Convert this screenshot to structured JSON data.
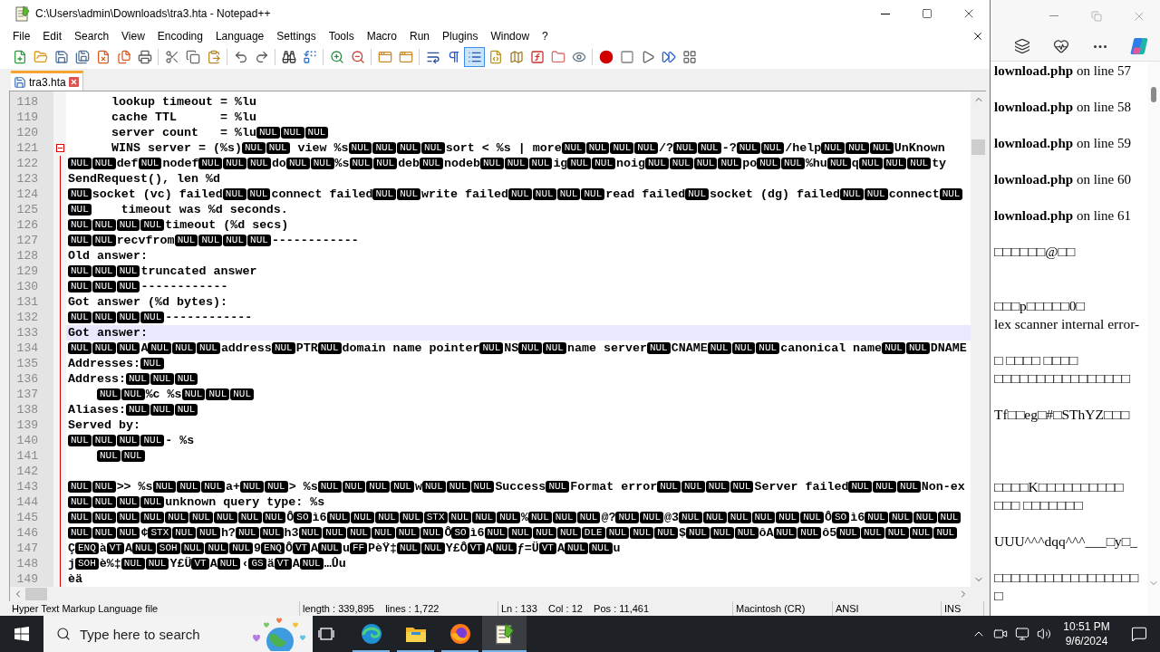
{
  "window": {
    "title": "C:\\Users\\admin\\Downloads\\tra3.hta - Notepad++"
  },
  "menu": [
    "File",
    "Edit",
    "Search",
    "View",
    "Encoding",
    "Language",
    "Settings",
    "Tools",
    "Macro",
    "Run",
    "Plugins",
    "Window",
    "?"
  ],
  "toolbar": [
    [
      {
        "selected": false
      },
      {
        "selected": false
      },
      {
        "selected": false
      },
      {
        "selected": false
      },
      {
        "selected": false
      },
      {
        "selected": false
      },
      {
        "selected": false
      }
    ],
    [
      {
        "selected": false
      },
      {
        "selected": false
      },
      {
        "selected": false
      }
    ],
    [
      {
        "selected": false
      },
      {
        "selected": false
      }
    ],
    [
      {
        "selected": false
      },
      {
        "selected": false
      }
    ],
    [
      {
        "selected": false
      },
      {
        "selected": false
      }
    ],
    [
      {
        "selected": false
      },
      {
        "selected": false
      }
    ],
    [
      {
        "selected": false
      },
      {
        "selected": false
      },
      {
        "selected": true
      },
      {
        "selected": false
      },
      {
        "selected": false
      },
      {
        "selected": false
      },
      {
        "selected": false
      },
      {
        "selected": false
      }
    ],
    [
      {
        "selected": false
      },
      {
        "selected": false
      },
      {
        "selected": false
      },
      {
        "selected": false
      },
      {
        "selected": false
      }
    ]
  ],
  "tabs": [
    {
      "label": "tra3.hta",
      "selected": true
    }
  ],
  "editor": {
    "lines": [
      {
        "number": "118",
        "current": false,
        "segments": [
          "      lookup timeout = %lu"
        ]
      },
      {
        "number": "119",
        "current": false,
        "segments": [
          "      cache TTL      = %lu"
        ]
      },
      {
        "number": "120",
        "current": false,
        "segments": [
          "      server count   = %lu",
          {
            "ctrl": "NUL"
          },
          {
            "ctrl": "NUL"
          },
          {
            "ctrl": "NUL"
          }
        ]
      },
      {
        "number": "121",
        "current": false,
        "expanded": true,
        "segments": [
          "      WINS server = (%s)",
          {
            "ctrl": "NUL"
          },
          {
            "ctrl": "NUL"
          },
          " view %s",
          {
            "ctrl": "NUL"
          },
          {
            "ctrl": "NUL"
          },
          {
            "ctrl": "NUL"
          },
          {
            "ctrl": "NUL"
          },
          "sort < %s | more",
          {
            "ctrl": "NUL"
          },
          {
            "ctrl": "NUL"
          },
          {
            "ctrl": "NUL"
          },
          {
            "ctrl": "NUL"
          },
          "/?",
          {
            "ctrl": "NUL"
          },
          {
            "ctrl": "NUL"
          },
          "-?",
          {
            "ctrl": "NUL"
          },
          {
            "ctrl": "NUL"
          },
          "/help",
          {
            "ctrl": "NUL"
          },
          {
            "ctrl": "NUL"
          },
          {
            "ctrl": "NUL"
          },
          "UnKnown"
        ]
      },
      {
        "number": "122",
        "current": false,
        "segments": [
          {
            "ctrl": "NUL"
          },
          {
            "ctrl": "NUL"
          },
          "def",
          {
            "ctrl": "NUL"
          },
          "nodef",
          {
            "ctrl": "NUL"
          },
          {
            "ctrl": "NUL"
          },
          {
            "ctrl": "NUL"
          },
          "do",
          {
            "ctrl": "NUL"
          },
          {
            "ctrl": "NUL"
          },
          "%s",
          {
            "ctrl": "NUL"
          },
          {
            "ctrl": "NUL"
          },
          "deb",
          {
            "ctrl": "NUL"
          },
          "nodeb",
          {
            "ctrl": "NUL"
          },
          {
            "ctrl": "NUL"
          },
          {
            "ctrl": "NUL"
          },
          "ig",
          {
            "ctrl": "NUL"
          },
          {
            "ctrl": "NUL"
          },
          "noig",
          {
            "ctrl": "NUL"
          },
          {
            "ctrl": "NUL"
          },
          {
            "ctrl": "NUL"
          },
          {
            "ctrl": "NUL"
          },
          "po",
          {
            "ctrl": "NUL"
          },
          {
            "ctrl": "NUL"
          },
          "%hu",
          {
            "ctrl": "NUL"
          },
          "q",
          {
            "ctrl": "NUL"
          },
          {
            "ctrl": "NUL"
          },
          {
            "ctrl": "NUL"
          },
          "ty"
        ]
      },
      {
        "number": "123",
        "current": false,
        "segments": [
          "SendRequest(), len %d"
        ]
      },
      {
        "number": "124",
        "current": false,
        "segments": [
          {
            "ctrl": "NUL"
          },
          "socket (vc) failed",
          {
            "ctrl": "NUL"
          },
          {
            "ctrl": "NUL"
          },
          "connect failed",
          {
            "ctrl": "NUL"
          },
          {
            "ctrl": "NUL"
          },
          "write failed",
          {
            "ctrl": "NUL"
          },
          {
            "ctrl": "NUL"
          },
          {
            "ctrl": "NUL"
          },
          {
            "ctrl": "NUL"
          },
          "read failed",
          {
            "ctrl": "NUL"
          },
          "socket (dg) failed",
          {
            "ctrl": "NUL"
          },
          {
            "ctrl": "NUL"
          },
          "connect",
          {
            "ctrl": "NUL"
          }
        ]
      },
      {
        "number": "125",
        "current": false,
        "segments": [
          {
            "ctrl": "NUL"
          },
          "    timeout was %d seconds."
        ]
      },
      {
        "number": "126",
        "current": false,
        "segments": [
          {
            "ctrl": "NUL"
          },
          {
            "ctrl": "NUL"
          },
          {
            "ctrl": "NUL"
          },
          {
            "ctrl": "NUL"
          },
          "timeout (%d secs)"
        ]
      },
      {
        "number": "127",
        "current": false,
        "segments": [
          {
            "ctrl": "NUL"
          },
          {
            "ctrl": "NUL"
          },
          "recvfrom",
          {
            "ctrl": "NUL"
          },
          {
            "ctrl": "NUL"
          },
          {
            "ctrl": "NUL"
          },
          {
            "ctrl": "NUL"
          },
          "------------"
        ]
      },
      {
        "number": "128",
        "current": false,
        "segments": [
          "Old answer:"
        ]
      },
      {
        "number": "129",
        "current": false,
        "segments": [
          {
            "ctrl": "NUL"
          },
          {
            "ctrl": "NUL"
          },
          {
            "ctrl": "NUL"
          },
          "truncated answer"
        ]
      },
      {
        "number": "130",
        "current": false,
        "segments": [
          {
            "ctrl": "NUL"
          },
          {
            "ctrl": "NUL"
          },
          {
            "ctrl": "NUL"
          },
          "------------"
        ]
      },
      {
        "number": "131",
        "current": false,
        "segments": [
          "Got answer (%d bytes):"
        ]
      },
      {
        "number": "132",
        "current": false,
        "segments": [
          {
            "ctrl": "NUL"
          },
          {
            "ctrl": "NUL"
          },
          {
            "ctrl": "NUL"
          },
          {
            "ctrl": "NUL"
          },
          "------------"
        ]
      },
      {
        "number": "133",
        "current": true,
        "segments": [
          "Got answer:"
        ]
      },
      {
        "number": "134",
        "current": false,
        "segments": [
          {
            "ctrl": "NUL"
          },
          {
            "ctrl": "NUL"
          },
          {
            "ctrl": "NUL"
          },
          "A",
          {
            "ctrl": "NUL"
          },
          {
            "ctrl": "NUL"
          },
          {
            "ctrl": "NUL"
          },
          "address",
          {
            "ctrl": "NUL"
          },
          "PTR",
          {
            "ctrl": "NUL"
          },
          "domain name pointer",
          {
            "ctrl": "NUL"
          },
          "NS",
          {
            "ctrl": "NUL"
          },
          {
            "ctrl": "NUL"
          },
          "name server",
          {
            "ctrl": "NUL"
          },
          "CNAME",
          {
            "ctrl": "NUL"
          },
          {
            "ctrl": "NUL"
          },
          {
            "ctrl": "NUL"
          },
          "canonical name",
          {
            "ctrl": "NUL"
          },
          {
            "ctrl": "NUL"
          },
          "DNAME"
        ]
      },
      {
        "number": "135",
        "current": false,
        "segments": [
          "Addresses:",
          {
            "ctrl": "NUL"
          }
        ]
      },
      {
        "number": "136",
        "current": false,
        "segments": [
          "Address:",
          {
            "ctrl": "NUL"
          },
          {
            "ctrl": "NUL"
          },
          {
            "ctrl": "NUL"
          }
        ]
      },
      {
        "number": "137",
        "current": false,
        "indented": true,
        "segments": [
          {
            "ctrl": "NUL"
          },
          {
            "ctrl": "NUL"
          },
          "%c %s",
          {
            "ctrl": "NUL"
          },
          {
            "ctrl": "NUL"
          },
          {
            "ctrl": "NUL"
          }
        ]
      },
      {
        "number": "138",
        "current": false,
        "segments": [
          "Aliases:",
          {
            "ctrl": "NUL"
          },
          {
            "ctrl": "NUL"
          },
          {
            "ctrl": "NUL"
          }
        ]
      },
      {
        "number": "139",
        "current": false,
        "segments": [
          "Served by:"
        ]
      },
      {
        "number": "140",
        "current": false,
        "segments": [
          {
            "ctrl": "NUL"
          },
          {
            "ctrl": "NUL"
          },
          {
            "ctrl": "NUL"
          },
          {
            "ctrl": "NUL"
          },
          "- %s"
        ]
      },
      {
        "number": "141",
        "current": false,
        "indented": true,
        "segments": [
          {
            "ctrl": "NUL"
          },
          {
            "ctrl": "NUL"
          }
        ]
      },
      {
        "number": "142",
        "current": false
      },
      {
        "number": "143",
        "current": false,
        "segments": [
          {
            "ctrl": "NUL"
          },
          {
            "ctrl": "NUL"
          },
          ">> %s",
          {
            "ctrl": "NUL"
          },
          {
            "ctrl": "NUL"
          },
          {
            "ctrl": "NUL"
          },
          "a+",
          {
            "ctrl": "NUL"
          },
          {
            "ctrl": "NUL"
          },
          "> %s",
          {
            "ctrl": "NUL"
          },
          {
            "ctrl": "NUL"
          },
          {
            "ctrl": "NUL"
          },
          {
            "ctrl": "NUL"
          },
          "w",
          {
            "ctrl": "NUL"
          },
          {
            "ctrl": "NUL"
          },
          {
            "ctrl": "NUL"
          },
          "Success",
          {
            "ctrl": "NUL"
          },
          "Format error",
          {
            "ctrl": "NUL"
          },
          {
            "ctrl": "NUL"
          },
          {
            "ctrl": "NUL"
          },
          {
            "ctrl": "NUL"
          },
          "Server failed",
          {
            "ctrl": "NUL"
          },
          {
            "ctrl": "NUL"
          },
          {
            "ctrl": "NUL"
          },
          "Non-ex"
        ]
      },
      {
        "number": "144",
        "current": false,
        "segments": [
          {
            "ctrl": "NUL"
          },
          {
            "ctrl": "NUL"
          },
          {
            "ctrl": "NUL"
          },
          {
            "ctrl": "NUL"
          },
          "unknown query type: %s"
        ]
      },
      {
        "number": "145",
        "current": false,
        "segments": [
          {
            "ctrl": "NUL"
          },
          {
            "ctrl": "NUL"
          },
          {
            "ctrl": "NUL"
          },
          {
            "ctrl": "NUL"
          },
          {
            "ctrl": "NUL"
          },
          {
            "ctrl": "NUL"
          },
          {
            "ctrl": "NUL"
          },
          {
            "ctrl": "NUL"
          },
          {
            "ctrl": "NUL"
          },
          "Ô",
          {
            "ctrl": "SO"
          },
          "ì6",
          {
            "ctrl": "NUL"
          },
          {
            "ctrl": "NUL"
          },
          {
            "ctrl": "NUL"
          },
          {
            "ctrl": "NUL"
          },
          {
            "ctrl": "STX"
          },
          {
            "ctrl": "NUL"
          },
          {
            "ctrl": "NUL"
          },
          {
            "ctrl": "NUL"
          },
          "%",
          {
            "ctrl": "NUL"
          },
          {
            "ctrl": "NUL"
          },
          {
            "ctrl": "NUL"
          },
          "@?",
          {
            "ctrl": "NUL"
          },
          {
            "ctrl": "NUL"
          },
          "@3",
          {
            "ctrl": "NUL"
          },
          {
            "ctrl": "NUL"
          },
          {
            "ctrl": "NUL"
          },
          {
            "ctrl": "NUL"
          },
          {
            "ctrl": "NUL"
          },
          {
            "ctrl": "NUL"
          },
          "Ô",
          {
            "ctrl": "SO"
          },
          "ì6",
          {
            "ctrl": "NUL"
          },
          {
            "ctrl": "NUL"
          },
          {
            "ctrl": "NUL"
          },
          {
            "ctrl": "NUL"
          }
        ]
      },
      {
        "number": "146",
        "current": false,
        "segments": [
          {
            "ctrl": "NUL"
          },
          {
            "ctrl": "NUL"
          },
          {
            "ctrl": "NUL"
          },
          "¢",
          {
            "ctrl": "STX"
          },
          {
            "ctrl": "NUL"
          },
          {
            "ctrl": "NUL"
          },
          "h?",
          {
            "ctrl": "NUL"
          },
          {
            "ctrl": "NUL"
          },
          "h3",
          {
            "ctrl": "NUL"
          },
          {
            "ctrl": "NUL"
          },
          {
            "ctrl": "NUL"
          },
          {
            "ctrl": "NUL"
          },
          {
            "ctrl": "NUL"
          },
          {
            "ctrl": "NUL"
          },
          "Ô",
          {
            "ctrl": "SO"
          },
          "ì6",
          {
            "ctrl": "NUL"
          },
          {
            "ctrl": "NUL"
          },
          {
            "ctrl": "NUL"
          },
          {
            "ctrl": "NUL"
          },
          {
            "ctrl": "DLE"
          },
          {
            "ctrl": "NUL"
          },
          {
            "ctrl": "NUL"
          },
          {
            "ctrl": "NUL"
          },
          "$",
          {
            "ctrl": "NUL"
          },
          {
            "ctrl": "NUL"
          },
          {
            "ctrl": "NUL"
          },
          "ôA",
          {
            "ctrl": "NUL"
          },
          {
            "ctrl": "NUL"
          },
          "ô5",
          {
            "ctrl": "NUL"
          },
          {
            "ctrl": "NUL"
          },
          {
            "ctrl": "NUL"
          },
          {
            "ctrl": "NUL"
          },
          {
            "ctrl": "NUL"
          }
        ]
      },
      {
        "number": "147",
        "current": false,
        "segments": [
          "Ç",
          {
            "ctrl": "ENQ"
          },
          "à",
          {
            "ctrl": "VT"
          },
          "A",
          {
            "ctrl": "NUL"
          },
          {
            "ctrl": "SOH"
          },
          {
            "ctrl": "NUL"
          },
          {
            "ctrl": "NUL"
          },
          {
            "ctrl": "NUL"
          },
          "9",
          {
            "ctrl": "ENQ"
          },
          "Ô",
          {
            "ctrl": "VT"
          },
          "A",
          {
            "ctrl": "NUL"
          },
          "u",
          {
            "ctrl": "FF"
          },
          "PèŸ‡",
          {
            "ctrl": "NUL"
          },
          {
            "ctrl": "NUL"
          },
          "Y£Ô",
          {
            "ctrl": "VT"
          },
          "A",
          {
            "ctrl": "NUL"
          },
          "ƒ=Ü",
          {
            "ctrl": "VT"
          },
          "A",
          {
            "ctrl": "NUL"
          },
          {
            "ctrl": "NUL"
          },
          "u"
        ]
      },
      {
        "number": "148",
        "current": false,
        "segments": [
          "j",
          {
            "ctrl": "SOH"
          },
          "è%‡",
          {
            "ctrl": "NUL"
          },
          {
            "ctrl": "NUL"
          },
          "Y£Ü",
          {
            "ctrl": "VT"
          },
          "A",
          {
            "ctrl": "NUL"
          },
          "‹",
          {
            "ctrl": "GS"
          },
          "ä",
          {
            "ctrl": "VT"
          },
          "A",
          {
            "ctrl": "NUL"
          },
          "…Ûu"
        ]
      },
      {
        "number": "149",
        "current": false,
        "segments": [
          "èä"
        ]
      }
    ]
  },
  "status_bar": [
    "Hyper Text Markup Language file",
    "length : 339,895    lines : 1,722",
    "Ln : 133    Col : 12    Pos : 11,461",
    "Macintosh (CR)",
    "ANSI",
    "INS"
  ],
  "browser": {
    "page_lines": [
      {
        "kind": "message",
        "text": "**lownload.php** on line 57"
      },
      {
        "kind": "blank"
      },
      {
        "kind": "message",
        "text": "**lownload.php** on line 58"
      },
      {
        "kind": "blank"
      },
      {
        "kind": "message",
        "text": "**lownload.php** on line 59"
      },
      {
        "kind": "blank"
      },
      {
        "kind": "message",
        "text": "**lownload.php** on line 60"
      },
      {
        "kind": "blank"
      },
      {
        "kind": "message",
        "text": "**lownload.php** on line 61"
      },
      {
        "kind": "blank"
      },
      {
        "kind": "text",
        "text": "□□□□□□@□□"
      },
      {
        "kind": "blank"
      },
      {
        "kind": "blank"
      },
      {
        "kind": "text",
        "text": "□□□p□□□□□0□"
      },
      {
        "kind": "text",
        "text": "lex scanner internal error-"
      },
      {
        "kind": "blank"
      },
      {
        "kind": "text",
        "text": "□ □□□□ □□□□"
      },
      {
        "kind": "text",
        "text": "□□□□□□□□□□□□□□□□"
      },
      {
        "kind": "blank"
      },
      {
        "kind": "text",
        "text": "Tf□□eg□#□SThYZ□□□"
      },
      {
        "kind": "blank"
      },
      {
        "kind": "blank"
      },
      {
        "kind": "blank"
      },
      {
        "kind": "text",
        "text": "□□□□K□□□□□□□□□□"
      },
      {
        "kind": "text",
        "text": "□□□ □□□□□□□"
      },
      {
        "kind": "blank"
      },
      {
        "kind": "text",
        "text": "UUU^^^dqq^^^___□y□_"
      },
      {
        "kind": "blank"
      },
      {
        "kind": "text",
        "text": "□□□□□□□□□□□□□□□□□"
      },
      {
        "kind": "text",
        "text": "□"
      }
    ]
  },
  "taskbar": {
    "search": {
      "placeholder": "Type here to search"
    },
    "apps": [
      {
        "running": true,
        "selected": false
      },
      {
        "running": true,
        "selected": false
      },
      {
        "running": true,
        "selected": false
      },
      {
        "running": true,
        "selected": true
      }
    ],
    "clock": {
      "time": "10:51 PM",
      "date": "9/6/2024"
    }
  }
}
